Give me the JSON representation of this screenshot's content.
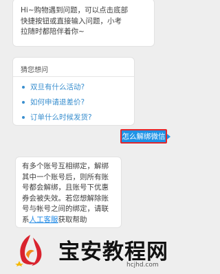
{
  "greeting": {
    "lines": [
      "Hi~购物遇到问题，可以点击底部",
      "快捷按钮或直接输入问题，小考",
      "拉随时都陪伴着你~"
    ]
  },
  "guess": {
    "title": "猜您想问",
    "questions": [
      "双旦有什么活动?",
      "如何申请退差价?",
      "订单什么时候发货?"
    ]
  },
  "user_message": "怎么解绑微信",
  "reply": {
    "lines": [
      "有多个账号互相绑定，解绑",
      "其中一个账号后，则所有账",
      "号都会解绑，且账号下优惠",
      "券会被失效。若您想解除账",
      "号与帐号之间的绑定，请联"
    ],
    "last_prefix": "系",
    "link_text": "人工客服",
    "last_suffix": "获取帮助"
  },
  "watermark": {
    "brand": "宝安教程网",
    "domain": "hcjhd.com"
  },
  "colors": {
    "link_blue": "#3a8fcf",
    "user_bubble": "#1e93e6",
    "highlight_red": "#e3262b",
    "logo_red": "#d9232e",
    "logo_orange": "#f08c1c"
  }
}
